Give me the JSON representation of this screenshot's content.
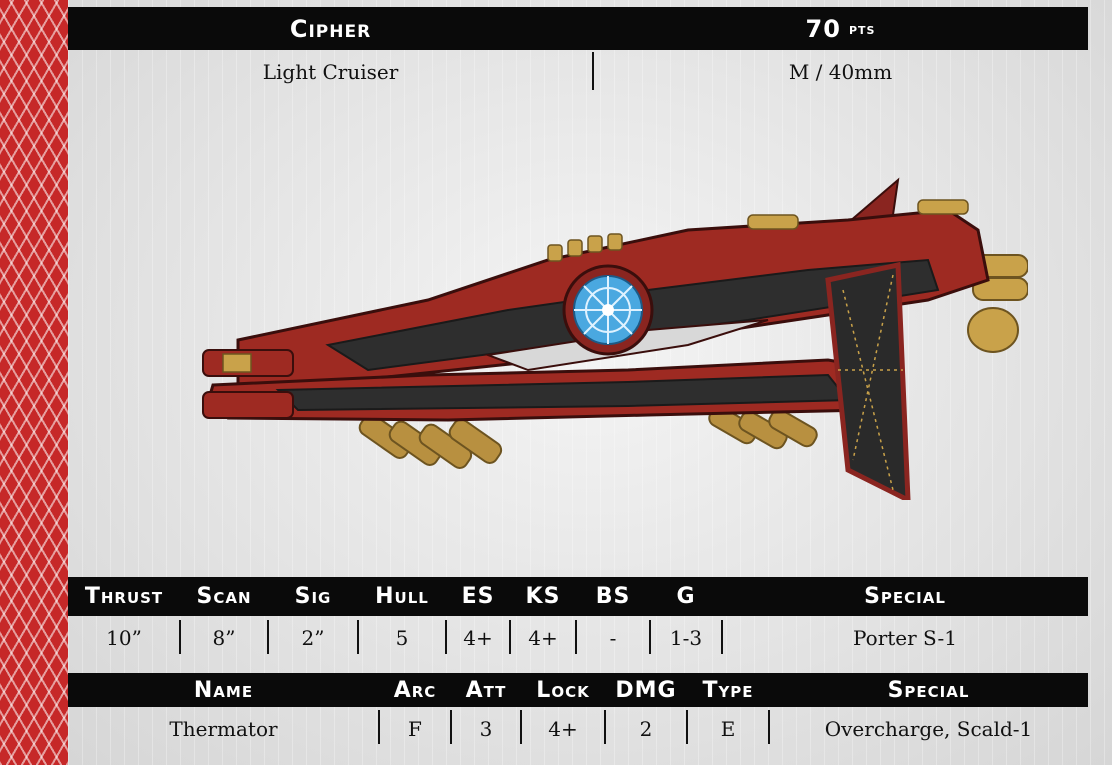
{
  "header": {
    "name": "Cipher",
    "points": "70",
    "points_unit": "pts",
    "class": "Light Cruiser",
    "size": "M / 40mm"
  },
  "stats": {
    "headers": [
      "Thrust",
      "Scan",
      "Sig",
      "Hull",
      "ES",
      "KS",
      "BS",
      "G",
      "Special"
    ],
    "values": [
      "10”",
      "8”",
      "2”",
      "5",
      "4+",
      "4+",
      "-",
      "1-3",
      "Porter S-1"
    ]
  },
  "weapons": {
    "headers": [
      "Name",
      "Arc",
      "Att",
      "Lock",
      "DMG",
      "Type",
      "Special"
    ],
    "rows": [
      [
        "Thermator",
        "F",
        "3",
        "4+",
        "2",
        "E",
        "Overcharge, Scald-1"
      ]
    ]
  },
  "colors": {
    "accent_red": "#c62828",
    "bar_black": "#0a0a0a",
    "hull_red": "#9e2a22",
    "hull_dark": "#2e2e2e",
    "core_blue": "#4aa8e0",
    "gold": "#c9a24a"
  }
}
